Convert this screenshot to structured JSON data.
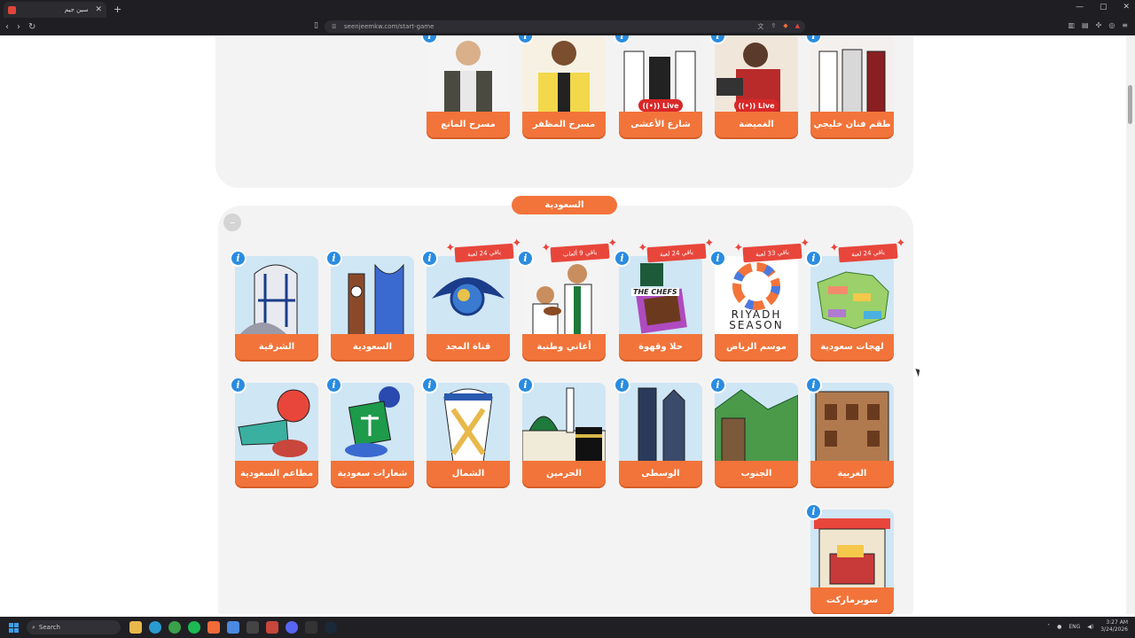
{
  "browser": {
    "tab_title": "سين جيم",
    "url": "seenjeemkw.com/start-game"
  },
  "section_top": {
    "cards": [
      {
        "label": "طقم فنان خليجي",
        "live": ""
      },
      {
        "label": "الغميضة",
        "live": "Live"
      },
      {
        "label": "شارع الأعشى",
        "live": "Live"
      },
      {
        "label": "مسرح المظفر",
        "live": ""
      },
      {
        "label": "مسرح المانع",
        "live": ""
      }
    ]
  },
  "section_saudi": {
    "category_title": "السعودية",
    "collapse_symbol": "–",
    "row1": [
      {
        "label": "لهجات سعودية",
        "ribbon": "باقي 24 لعبة"
      },
      {
        "label": "موسم الرياض",
        "ribbon": "باقي 33 لعبة"
      },
      {
        "label": "حلا وقهوة",
        "ribbon": "باقي 24 لعبة"
      },
      {
        "label": "أغاني وطنية",
        "ribbon": "باقي 9 ألعاب"
      },
      {
        "label": "قناة المجد",
        "ribbon": "باقي 24 لعبة"
      },
      {
        "label": "السعودية",
        "ribbon": ""
      },
      {
        "label": "الشرقية",
        "ribbon": ""
      }
    ],
    "row2": [
      {
        "label": "الغربية"
      },
      {
        "label": "الجنوب"
      },
      {
        "label": "الوسطى"
      },
      {
        "label": "الحرمين"
      },
      {
        "label": "الشمال"
      },
      {
        "label": "شعارات سعودية"
      },
      {
        "label": "مطاعم السعودية"
      }
    ],
    "row3": [
      {
        "label": "سوبرماركت"
      }
    ],
    "riyadh_logo_text": "RIYADH SEASON",
    "coffee_logo_text": "THE CHEFS"
  },
  "info_glyph": "i",
  "taskbar": {
    "search_label": "Search",
    "lang": "ENG",
    "time": "3:27 AM",
    "date": "3/24/2026"
  },
  "colors": {
    "accent": "#f2743a",
    "info": "#2a8ce0",
    "live": "#d92828"
  }
}
